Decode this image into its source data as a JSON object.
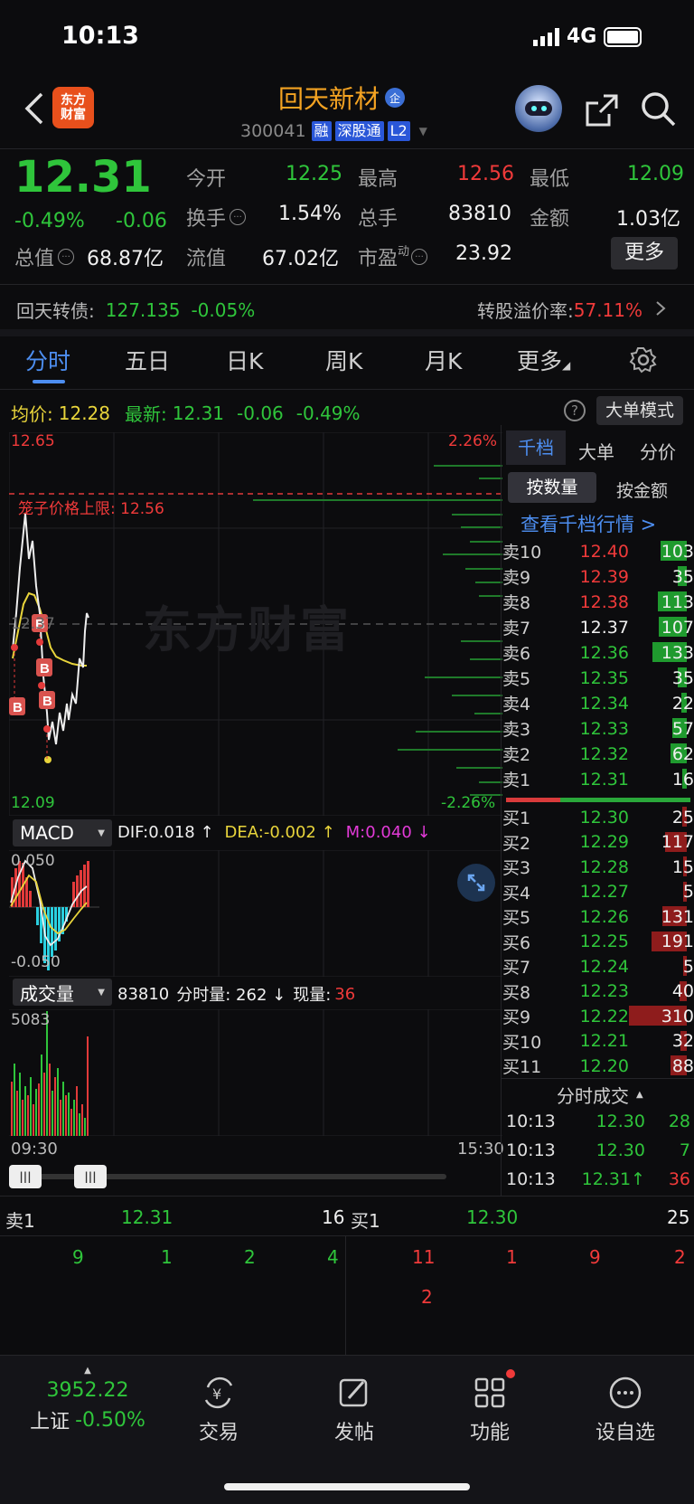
{
  "status_bar": {
    "time": "10:13",
    "network": "4G"
  },
  "header": {
    "logo_text": "东方财富",
    "title": "回天新材",
    "title_badge": "企",
    "code": "300041",
    "tags": [
      "融",
      "深股通",
      "L2"
    ]
  },
  "quote": {
    "price": "12.31",
    "change_pct": "-0.49%",
    "change": "-0.06",
    "open_label": "今开",
    "open": "12.25",
    "high_label": "最高",
    "high": "12.56",
    "low_label": "最低",
    "low": "12.09",
    "turnover_label": "换手",
    "turnover": "1.54%",
    "volume_label": "总手",
    "volume": "83810",
    "amount_label": "金额",
    "amount": "1.03亿",
    "mktcap_label": "总值",
    "mktcap": "68.87亿",
    "float_label": "流值",
    "float_cap": "67.02亿",
    "pe_label": "市盈",
    "pe_sup": "动",
    "pe": "23.92",
    "more_label": "更多"
  },
  "bond": {
    "label": "回天转债:",
    "price": "127.135",
    "change": "-0.05%",
    "premium_label": "转股溢价率:",
    "premium": "57.11%"
  },
  "tabs": [
    "分时",
    "五日",
    "日K",
    "周K",
    "月K",
    "更多"
  ],
  "chart_header": {
    "avg_label": "均价:",
    "avg": "12.28",
    "latest_label": "最新:",
    "latest": "12.31",
    "latest_chg": "-0.06",
    "latest_pct": "-0.49%",
    "mode_button": "大单模式"
  },
  "chart_labels": {
    "top_price": "12.65",
    "top_pct": "2.26%",
    "limit_label": "笼子价格上限: 12.56",
    "mid_price": "12.37",
    "bottom_price": "12.09",
    "bottom_pct": "-2.26%",
    "watermark": "东方财富"
  },
  "macd": {
    "selector": "MACD",
    "dif": "DIF:0.018 ↑",
    "dea": "DEA:-0.002 ↑",
    "m": "M:0.040 ↓",
    "top": "0.050",
    "bottom": "-0.050"
  },
  "volume_panel": {
    "selector": "成交量",
    "total": "83810",
    "minute_label": "分时量: 262 ↓",
    "now_label": "现量:",
    "now": "36",
    "max": "5083",
    "start_time": "09:30",
    "end_time": "15:30"
  },
  "orderbook": {
    "tabs": [
      "千档",
      "大单",
      "分价"
    ],
    "toggles": [
      "按数量",
      "按金额"
    ],
    "link": "查看千档行情 >",
    "asks": [
      {
        "label": "卖10",
        "price": "12.40",
        "vol": "103",
        "color": "red"
      },
      {
        "label": "卖9",
        "price": "12.39",
        "vol": "35",
        "color": "red"
      },
      {
        "label": "卖8",
        "price": "12.38",
        "vol": "113",
        "color": "red"
      },
      {
        "label": "卖7",
        "price": "12.37",
        "vol": "107",
        "color": "white"
      },
      {
        "label": "卖6",
        "price": "12.36",
        "vol": "133",
        "color": "green"
      },
      {
        "label": "卖5",
        "price": "12.35",
        "vol": "35",
        "color": "green"
      },
      {
        "label": "卖4",
        "price": "12.34",
        "vol": "22",
        "color": "green"
      },
      {
        "label": "卖3",
        "price": "12.33",
        "vol": "57",
        "color": "green"
      },
      {
        "label": "卖2",
        "price": "12.32",
        "vol": "62",
        "color": "green"
      },
      {
        "label": "卖1",
        "price": "12.31",
        "vol": "16",
        "color": "green"
      }
    ],
    "bids": [
      {
        "label": "买1",
        "price": "12.30",
        "vol": "25"
      },
      {
        "label": "买2",
        "price": "12.29",
        "vol": "117"
      },
      {
        "label": "买3",
        "price": "12.28",
        "vol": "15"
      },
      {
        "label": "买4",
        "price": "12.27",
        "vol": "5"
      },
      {
        "label": "买5",
        "price": "12.26",
        "vol": "131"
      },
      {
        "label": "买6",
        "price": "12.25",
        "vol": "191"
      },
      {
        "label": "买7",
        "price": "12.24",
        "vol": "5"
      },
      {
        "label": "买8",
        "price": "12.23",
        "vol": "40"
      },
      {
        "label": "买9",
        "price": "12.22",
        "vol": "310"
      },
      {
        "label": "买10",
        "price": "12.21",
        "vol": "32"
      },
      {
        "label": "买11",
        "price": "12.20",
        "vol": "88"
      }
    ],
    "trades_title": "分时成交",
    "trades": [
      {
        "time": "10:13",
        "price": "12.30",
        "vol": "28"
      },
      {
        "time": "10:13",
        "price": "12.30",
        "vol": "7"
      },
      {
        "time": "10:13",
        "price": "12.31↑",
        "vol": "36"
      }
    ]
  },
  "queue": {
    "sell_label": "卖1",
    "sell_price": "12.31",
    "sell_vol": "16",
    "buy_label": "买1",
    "buy_price": "12.30",
    "buy_vol": "25",
    "sell_orders": [
      "9",
      "1",
      "2",
      "4"
    ],
    "buy_orders": [
      "11",
      "1",
      "9",
      "2",
      "2"
    ]
  },
  "bottom_nav": {
    "index_value": "3952.22",
    "index_label": "上证",
    "index_change": "-0.50%",
    "items": [
      "交易",
      "发帖",
      "功能",
      "设自选"
    ]
  }
}
